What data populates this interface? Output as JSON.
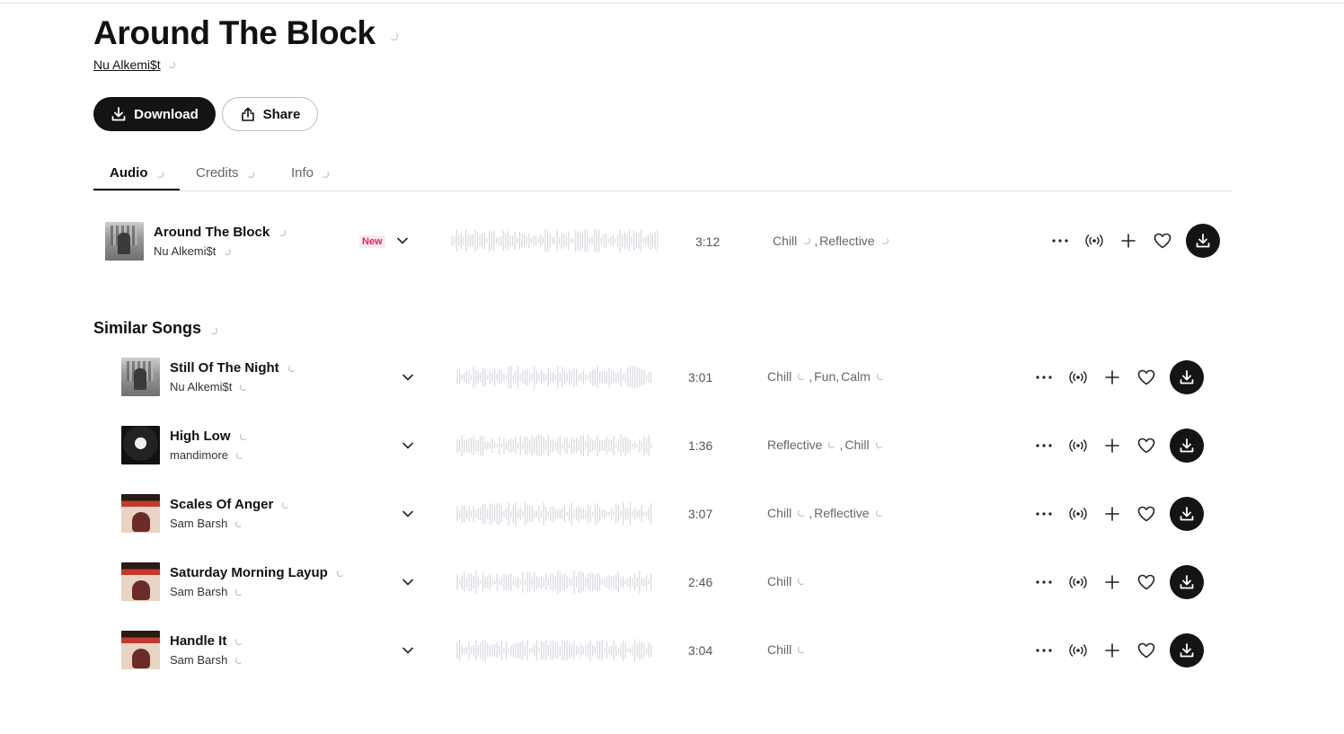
{
  "header": {
    "title": "Around The Block",
    "artist": "Nu Alkemi$t"
  },
  "actions": {
    "download_label": "Download",
    "share_label": "Share"
  },
  "tabs": [
    {
      "label": "Audio",
      "active": true
    },
    {
      "label": "Credits",
      "active": false
    },
    {
      "label": "Info",
      "active": false
    }
  ],
  "main_track": {
    "title": "Around The Block",
    "artist": "Nu Alkemi$t",
    "badge": "New",
    "duration": "3:12",
    "tags": [
      "Chill",
      "Reflective"
    ],
    "cover": "street-icon"
  },
  "similar": {
    "title": "Similar Songs",
    "tracks": [
      {
        "title": "Still Of The Night",
        "artist": "Nu Alkemi$t",
        "duration": "3:01",
        "tags": [
          "Chill",
          "Fun",
          "Calm"
        ],
        "cover": "street-icon"
      },
      {
        "title": "High Low",
        "artist": "mandimore",
        "duration": "1:36",
        "tags": [
          "Reflective",
          "Chill"
        ],
        "cover": "portrait-icon"
      },
      {
        "title": "Scales Of Anger",
        "artist": "Sam Barsh",
        "duration": "3:07",
        "tags": [
          "Chill",
          "Reflective"
        ],
        "cover": "piano-icon"
      },
      {
        "title": "Saturday Morning Layup",
        "artist": "Sam Barsh",
        "duration": "2:46",
        "tags": [
          "Chill"
        ],
        "cover": "piano-icon"
      },
      {
        "title": "Handle It",
        "artist": "Sam Barsh",
        "duration": "3:04",
        "tags": [
          "Chill"
        ],
        "cover": "piano-icon"
      }
    ]
  },
  "colors": {
    "primary": "#141414",
    "badge_new": "#e0245e",
    "badge_new_bg": "#fde8ef",
    "waveform": "#d6d9e0"
  }
}
